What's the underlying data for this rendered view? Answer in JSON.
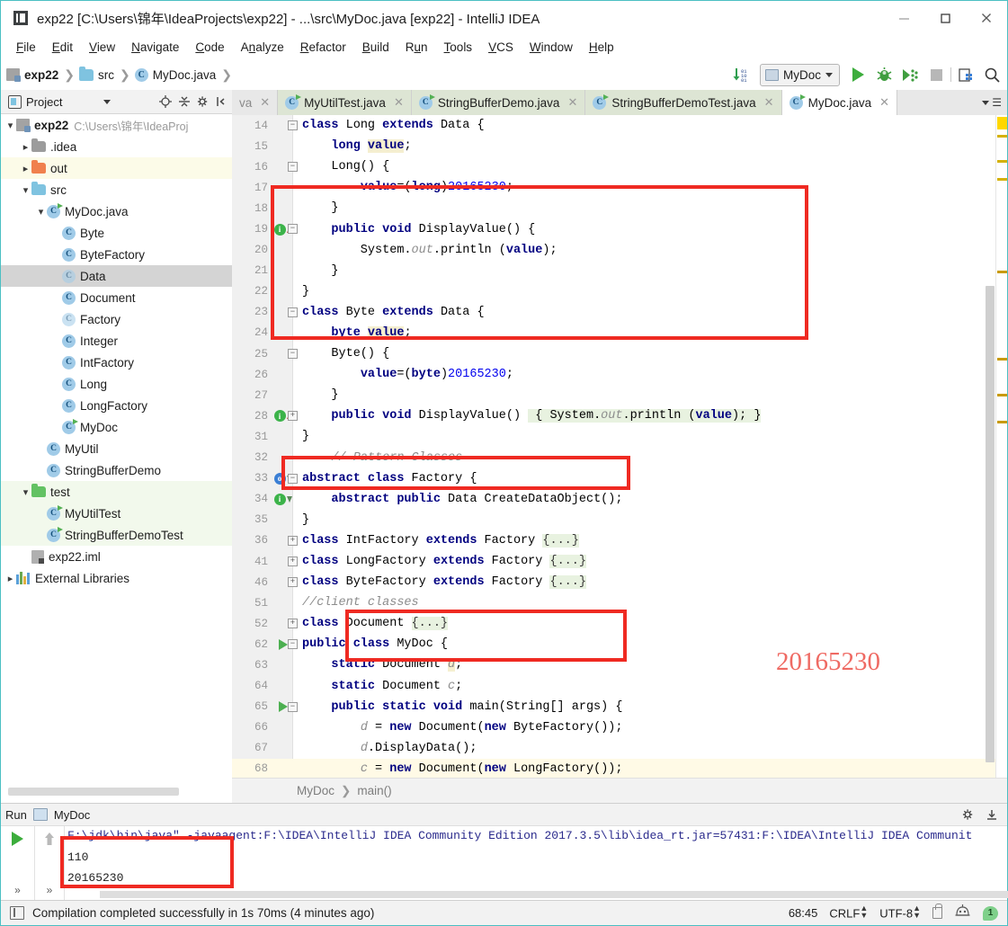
{
  "window": {
    "title": "exp22 [C:\\Users\\锦年\\IdeaProjects\\exp22] - ...\\src\\MyDoc.java [exp22] - IntelliJ IDEA",
    "minimize_label": "—",
    "maximize_label": "□",
    "close_label": "✕"
  },
  "menubar": {
    "items": [
      "File",
      "Edit",
      "View",
      "Navigate",
      "Code",
      "Analyze",
      "Refactor",
      "Build",
      "Run",
      "Tools",
      "VCS",
      "Window",
      "Help"
    ]
  },
  "navbar": {
    "breadcrumb": [
      "exp22",
      "src",
      "MyDoc.java"
    ],
    "run_config": "MyDoc"
  },
  "project_panel": {
    "title": "Project",
    "tree": [
      {
        "label": "exp22",
        "sub": "C:\\Users\\锦年\\IdeaProj",
        "indent": 0,
        "arrow": "v",
        "icon": "module-icon",
        "bold": true
      },
      {
        "label": ".idea",
        "sub": "",
        "indent": 1,
        "arrow": ">",
        "icon": "folder-gray-icon"
      },
      {
        "label": "out",
        "sub": "",
        "indent": 1,
        "arrow": ">",
        "icon": "folder-orange-icon",
        "row_bg": "yellow"
      },
      {
        "label": "src",
        "sub": "",
        "indent": 1,
        "arrow": "v",
        "icon": "folder-blue-icon"
      },
      {
        "label": "MyDoc.java",
        "sub": "",
        "indent": 2,
        "arrow": "v",
        "icon": "java-class-run-icon"
      },
      {
        "label": "Byte",
        "sub": "",
        "indent": 3,
        "arrow": "",
        "icon": "java-class-icon"
      },
      {
        "label": "ByteFactory",
        "sub": "",
        "indent": 3,
        "arrow": "",
        "icon": "java-class-icon"
      },
      {
        "label": "Data",
        "sub": "",
        "indent": 3,
        "arrow": "",
        "icon": "java-class-abstract-icon",
        "selected": true
      },
      {
        "label": "Document",
        "sub": "",
        "indent": 3,
        "arrow": "",
        "icon": "java-class-icon"
      },
      {
        "label": "Factory",
        "sub": "",
        "indent": 3,
        "arrow": "",
        "icon": "java-class-abstract-icon"
      },
      {
        "label": "Integer",
        "sub": "",
        "indent": 3,
        "arrow": "",
        "icon": "java-class-icon"
      },
      {
        "label": "IntFactory",
        "sub": "",
        "indent": 3,
        "arrow": "",
        "icon": "java-class-icon"
      },
      {
        "label": "Long",
        "sub": "",
        "indent": 3,
        "arrow": "",
        "icon": "java-class-icon"
      },
      {
        "label": "LongFactory",
        "sub": "",
        "indent": 3,
        "arrow": "",
        "icon": "java-class-icon"
      },
      {
        "label": "MyDoc",
        "sub": "",
        "indent": 3,
        "arrow": "",
        "icon": "java-class-run-icon"
      },
      {
        "label": "MyUtil",
        "sub": "",
        "indent": 2,
        "arrow": "",
        "icon": "java-class-icon"
      },
      {
        "label": "StringBufferDemo",
        "sub": "",
        "indent": 2,
        "arrow": "",
        "icon": "java-class-icon"
      },
      {
        "label": "test",
        "sub": "",
        "indent": 1,
        "arrow": "v",
        "icon": "folder-green-icon",
        "row_bg": "green"
      },
      {
        "label": "MyUtilTest",
        "sub": "",
        "indent": 2,
        "arrow": "",
        "icon": "java-class-run-icon",
        "row_bg": "green"
      },
      {
        "label": "StringBufferDemoTest",
        "sub": "",
        "indent": 2,
        "arrow": "",
        "icon": "java-class-run-icon",
        "row_bg": "green"
      },
      {
        "label": "exp22.iml",
        "sub": "",
        "indent": 1,
        "arrow": "",
        "icon": "iml-file-icon"
      },
      {
        "label": "External Libraries",
        "sub": "",
        "indent": 0,
        "arrow": ">",
        "icon": "library-icon"
      }
    ]
  },
  "editor": {
    "tabs": [
      {
        "label": "va",
        "state": "clipped"
      },
      {
        "label": "MyUtilTest.java",
        "state": "inactive"
      },
      {
        "label": "StringBufferDemo.java",
        "state": "inactive"
      },
      {
        "label": "StringBufferDemoTest.java",
        "state": "inactive"
      },
      {
        "label": "MyDoc.java",
        "state": "active"
      }
    ],
    "breadcrumb": [
      "MyDoc",
      "main()"
    ],
    "watermark": "20165230",
    "lines": [
      {
        "n": "14",
        "html": "<span class=\"kw\">class</span> Long <span class=\"kw\">extends</span> Data {",
        "indent": 0,
        "fold": "minus"
      },
      {
        "n": "15",
        "html": "    <span class=\"kw\">long</span> <span class=\"fld kw\">value</span>;",
        "indent": 0
      },
      {
        "n": "16",
        "html": "    Long() {",
        "indent": 0,
        "fold": "minus"
      },
      {
        "n": "17",
        "html": "        <span class=\"kw\">value</span>=(<span class=\"kw\">long</span>)<span class=\"num\">20165230</span>;",
        "indent": 0
      },
      {
        "n": "18",
        "html": "    }",
        "indent": 0
      },
      {
        "n": "19",
        "html": "    <span class=\"kw\">public</span> <span class=\"kw\">void</span> DisplayValue() {",
        "indent": 0,
        "gutter": "bulb-green-up",
        "fold": "minus"
      },
      {
        "n": "20",
        "html": "        System.<span class=\"cmt\">out</span>.println (<span class=\"kw\">value</span>);",
        "indent": 0
      },
      {
        "n": "21",
        "html": "    }",
        "indent": 0
      },
      {
        "n": "22",
        "html": "}",
        "indent": 0
      },
      {
        "n": "23",
        "html": "<span class=\"kw\">class</span> Byte <span class=\"kw\">extends</span> Data {",
        "indent": 0,
        "fold": "minus"
      },
      {
        "n": "24",
        "html": "    <span class=\"kw\">byte</span> <span class=\"fld kw\">value</span>;",
        "indent": 0
      },
      {
        "n": "25",
        "html": "    Byte() {",
        "indent": 0,
        "fold": "minus"
      },
      {
        "n": "26",
        "html": "        <span class=\"kw\">value</span>=(<span class=\"kw\">byte</span>)<span class=\"num\">20165230</span>;",
        "indent": 0
      },
      {
        "n": "27",
        "html": "    }",
        "indent": 0
      },
      {
        "n": "28",
        "html": "    <span class=\"kw\">public</span> <span class=\"kw\">void</span> DisplayValue() <span class=\"greenhl\"> { System.<span class=\"cmt\">out</span>.println (<span class=\"kw\">value</span>); }</span>",
        "indent": 0,
        "gutter": "bulb-green-up",
        "fold": "plus"
      },
      {
        "n": "31",
        "html": "}",
        "indent": 0
      },
      {
        "n": "32",
        "html": "    <span class=\"cmt\">// Pattern Classes</span>",
        "indent": 0
      },
      {
        "n": "33",
        "html": "<span class=\"kw\">abstract class</span> Factory {",
        "indent": 0,
        "gutter": "bulb-blue-down",
        "fold": "minus"
      },
      {
        "n": "34",
        "html": "    <span class=\"kw\">abstract public</span> Data CreateDataObject();",
        "indent": 0,
        "gutter": "bulb-green-down"
      },
      {
        "n": "35",
        "html": "}",
        "indent": 0
      },
      {
        "n": "36",
        "html": "<span class=\"kw\">class</span> IntFactory <span class=\"kw\">extends</span> Factory <span class=\"foldspan\">{...}</span>",
        "indent": 0,
        "fold": "plus"
      },
      {
        "n": "41",
        "html": "<span class=\"kw\">class</span> LongFactory <span class=\"kw\">extends</span> Factory <span class=\"foldspan\">{...}</span>",
        "indent": 0,
        "fold": "plus"
      },
      {
        "n": "46",
        "html": "<span class=\"kw\">class</span> ByteFactory <span class=\"kw\">extends</span> Factory <span class=\"foldspan\">{...}</span>",
        "indent": 0,
        "fold": "plus"
      },
      {
        "n": "51",
        "html": "<span class=\"cmt\">//client classes</span>",
        "indent": 0
      },
      {
        "n": "52",
        "html": "<span class=\"kw\">class</span> Document <span class=\"foldspan\">{...}</span>",
        "indent": 0,
        "fold": "plus"
      },
      {
        "n": "62",
        "html": "<span class=\"kw\">public class</span> MyDoc {",
        "indent": 0,
        "gutter": "run-arrow",
        "fold": "minus"
      },
      {
        "n": "63",
        "html": "    <span class=\"kw\">static</span> Document <span class=\"fld cmt\">d</span>;",
        "indent": 0
      },
      {
        "n": "64",
        "html": "    <span class=\"kw\">static</span> Document <span class=\"cmt\">c</span>;",
        "indent": 0
      },
      {
        "n": "65",
        "html": "    <span class=\"kw\">public static void</span> main(String[] args) {",
        "indent": 0,
        "gutter": "run-arrow",
        "fold": "minus"
      },
      {
        "n": "66",
        "html": "        <span class=\"cmt\">d</span> = <span class=\"kw\">new</span> Document(<span class=\"kw\">new</span> ByteFactory());",
        "indent": 0
      },
      {
        "n": "67",
        "html": "        <span class=\"cmt\">d</span>.DisplayData();",
        "indent": 0
      },
      {
        "n": "68",
        "html": "        <span class=\"cmt\">c</span> = <span class=\"kw\">new</span> Document(<span class=\"kw\">new</span> LongFactory());",
        "indent": 0,
        "hl": true
      }
    ]
  },
  "run_panel": {
    "tab_label": "Run",
    "config_label": "MyDoc",
    "console_lines": [
      "F:\\jdk\\bin\\java\" -javaagent:F:\\IDEA\\IntelliJ IDEA Community Edition 2017.3.5\\lib\\idea_rt.jar=57431:F:\\IDEA\\IntelliJ IDEA Communit",
      "110",
      "20165230"
    ]
  },
  "status_bar": {
    "message": "Compilation completed successfully in 1s 70ms (4 minutes ago)",
    "caret_position": "68:45",
    "line_separator": "CRLF",
    "encoding": "UTF-8",
    "notification_count": "1"
  }
}
